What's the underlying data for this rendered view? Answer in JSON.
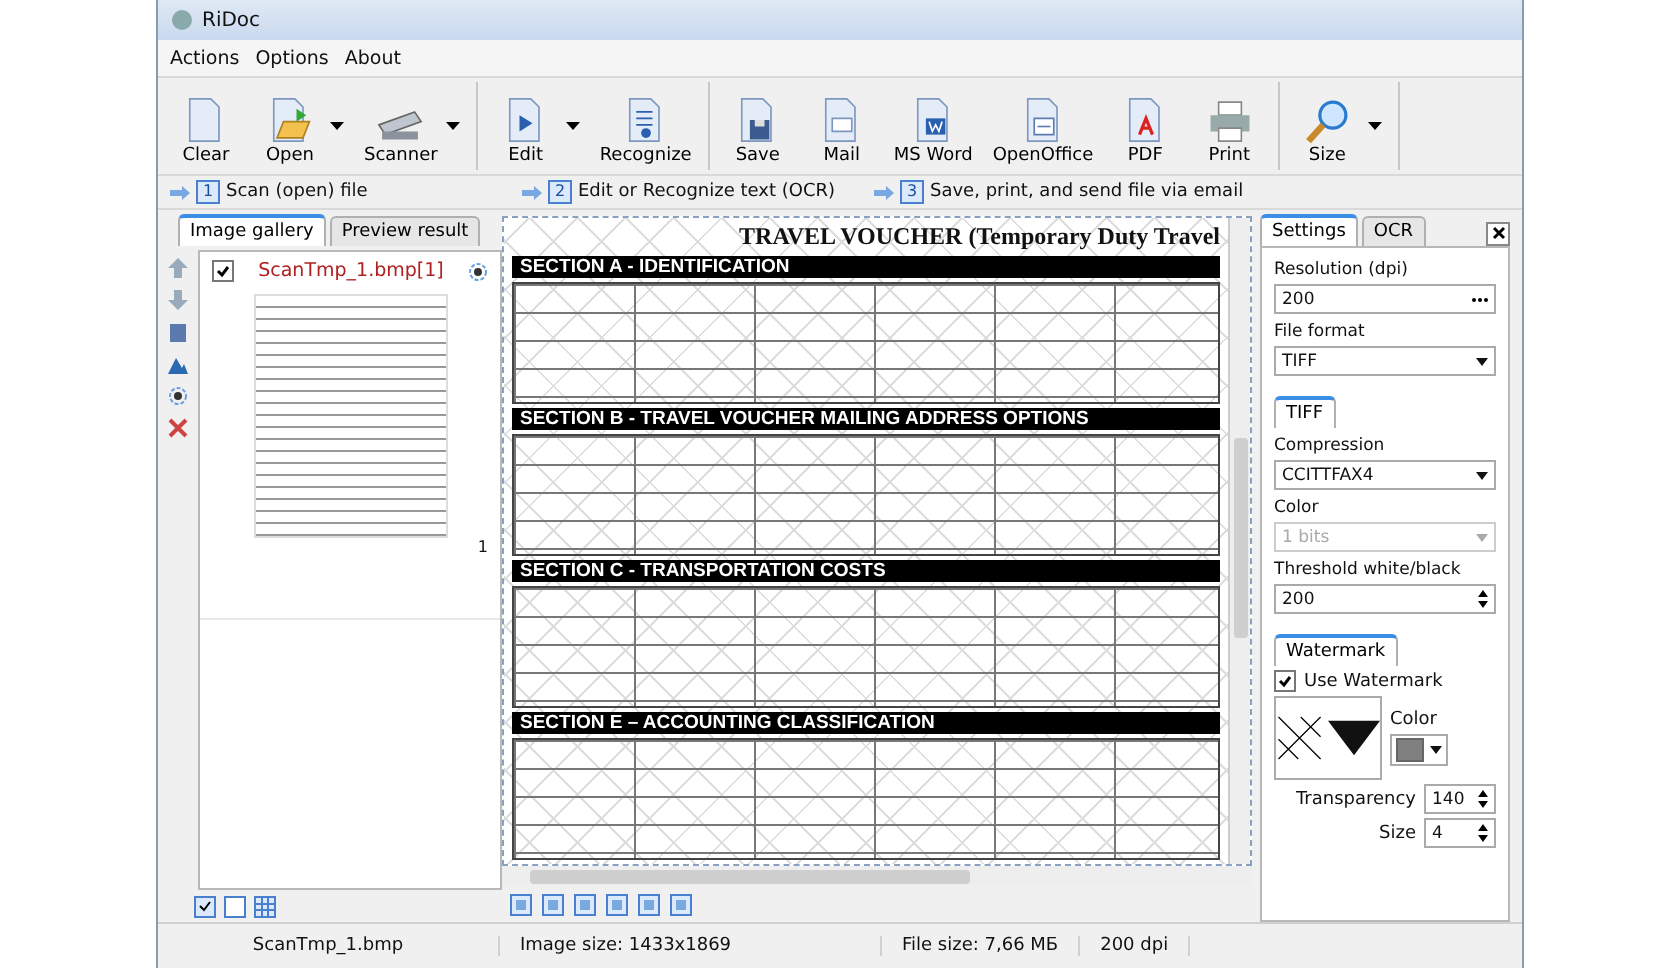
{
  "window": {
    "title": "RiDoc"
  },
  "menu": [
    "Actions",
    "Options",
    "About"
  ],
  "toolbar": [
    [
      {
        "label": "Clear",
        "kind": "doc",
        "dropdown": false
      },
      {
        "label": "Open",
        "kind": "open",
        "dropdown": true
      },
      {
        "label": "Scanner",
        "kind": "scanner",
        "dropdown": true
      }
    ],
    [
      {
        "label": "Edit",
        "kind": "edit",
        "dropdown": true
      },
      {
        "label": "Recognize",
        "kind": "recognize",
        "dropdown": false
      }
    ],
    [
      {
        "label": "Save",
        "kind": "save",
        "dropdown": false
      },
      {
        "label": "Mail",
        "kind": "mail",
        "dropdown": false
      },
      {
        "label": "MS Word",
        "kind": "word",
        "dropdown": false
      },
      {
        "label": "OpenOffice",
        "kind": "openoffice",
        "dropdown": false
      },
      {
        "label": "PDF",
        "kind": "pdf",
        "dropdown": false
      },
      {
        "label": "Print",
        "kind": "print",
        "dropdown": false
      }
    ],
    [
      {
        "label": "Size",
        "kind": "zoom",
        "dropdown": true
      }
    ]
  ],
  "steps": [
    {
      "number": "1",
      "label": "Scan (open) file"
    },
    {
      "number": "2",
      "label": "Edit or Recognize text (OCR)"
    },
    {
      "number": "3",
      "label": "Save, print, and send file via email"
    }
  ],
  "left_tabs": [
    {
      "label": "Image gallery",
      "selected": true
    },
    {
      "label": "Preview result",
      "selected": false
    }
  ],
  "gallery": [
    {
      "name": "ScanTmp_1.bmp[1]",
      "checked": true,
      "page": "1"
    }
  ],
  "preview": {
    "title": "TRAVEL VOUCHER (Temporary Duty Travel",
    "sections": [
      "SECTION A - IDENTIFICATION",
      "SECTION  B - TRAVEL VOUCHER MAILING ADDRESS OPTIONS",
      "SECTION C - TRANSPORTATION COSTS",
      "SECTION E – ACCOUNTING CLASSIFICATION"
    ]
  },
  "right_tabs": [
    {
      "label": "Settings",
      "selected": true
    },
    {
      "label": "OCR",
      "selected": false
    }
  ],
  "settings": {
    "resolution_label": "Resolution (dpi)",
    "resolution": "200",
    "format_label": "File format",
    "format": "TIFF",
    "tiff_tab": "TIFF",
    "compression_label": "Compression",
    "compression": "CCITTFAX4",
    "color_label": "Color",
    "color_mode": "1 bits",
    "color_disabled": true,
    "threshold_label": "Threshold white/black",
    "threshold": "200",
    "watermark_tab": "Watermark",
    "use_watermark_label": "Use Watermark",
    "use_watermark": true,
    "watermark_color_label": "Color",
    "transparency_label": "Transparency",
    "transparency": "140",
    "size_label": "Size",
    "size": "4"
  },
  "status_bar": [
    "ScanTmp_1.bmp",
    "Image size: 1433x1869",
    "File size: 7,66 МБ",
    "200 dpi"
  ]
}
